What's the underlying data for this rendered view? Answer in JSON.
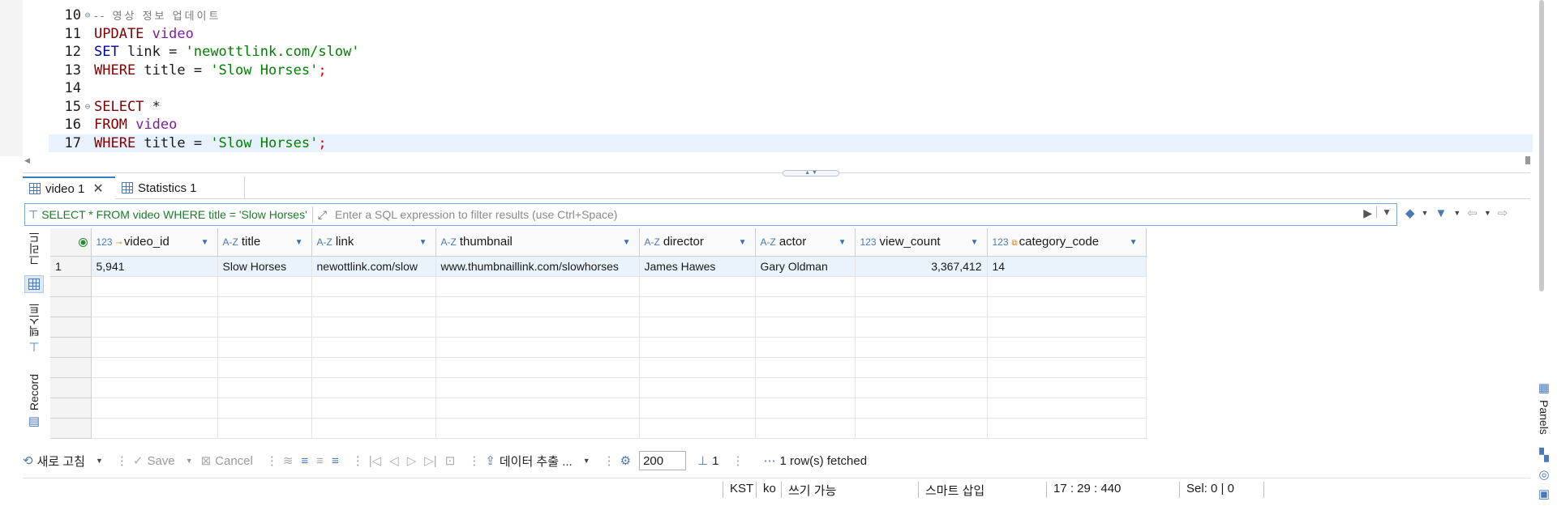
{
  "editor": {
    "lines": [
      {
        "n": "10",
        "fold": "⊖",
        "current": false,
        "tokens": [
          {
            "c": "cmt",
            "t": "-- 영상 정보 업데이트"
          }
        ]
      },
      {
        "n": "11",
        "fold": "",
        "current": false,
        "tokens": [
          {
            "c": "kw",
            "t": "UPDATE"
          },
          {
            "c": "",
            "t": " "
          },
          {
            "c": "id",
            "t": "video"
          }
        ]
      },
      {
        "n": "12",
        "fold": "",
        "current": false,
        "tokens": [
          {
            "c": "kw-blue",
            "t": "SET"
          },
          {
            "c": "",
            "t": " link = "
          },
          {
            "c": "str",
            "t": "'newottlink.com/slow'"
          }
        ]
      },
      {
        "n": "13",
        "fold": "",
        "current": false,
        "tokens": [
          {
            "c": "kw",
            "t": "WHERE"
          },
          {
            "c": "",
            "t": " title = "
          },
          {
            "c": "str",
            "t": "'Slow Horses'"
          },
          {
            "c": "sep",
            "t": ";"
          }
        ]
      },
      {
        "n": "14",
        "fold": "",
        "current": false,
        "tokens": []
      },
      {
        "n": "15",
        "fold": "⊖",
        "current": false,
        "tokens": [
          {
            "c": "kw",
            "t": "SELECT"
          },
          {
            "c": "",
            "t": " *"
          }
        ]
      },
      {
        "n": "16",
        "fold": "",
        "current": false,
        "tokens": [
          {
            "c": "kw",
            "t": "FROM"
          },
          {
            "c": "",
            "t": " "
          },
          {
            "c": "id",
            "t": "video"
          }
        ]
      },
      {
        "n": "17",
        "fold": "",
        "current": true,
        "tokens": [
          {
            "c": "kw",
            "t": "WHERE"
          },
          {
            "c": "",
            "t": " title = "
          },
          {
            "c": "str",
            "t": "'Slow Horses'"
          },
          {
            "c": "sep",
            "t": ";"
          }
        ]
      }
    ]
  },
  "tabs": {
    "active_label": "video 1",
    "other_label": "Statistics 1"
  },
  "filter": {
    "query": "SELECT * FROM video WHERE title = 'Slow Horses'",
    "placeholder": "Enter a SQL expression to filter results (use Ctrl+Space)"
  },
  "view_switcher": {
    "grid_label": "그리드",
    "text_label": "텍스트",
    "record_label": "Record"
  },
  "grid": {
    "columns": [
      {
        "type": "123",
        "name": "video_id",
        "key": true
      },
      {
        "type": "A-Z",
        "name": "title"
      },
      {
        "type": "A-Z",
        "name": "link"
      },
      {
        "type": "A-Z",
        "name": "thumbnail"
      },
      {
        "type": "A-Z",
        "name": "director"
      },
      {
        "type": "A-Z",
        "name": "actor"
      },
      {
        "type": "123",
        "name": "view_count"
      },
      {
        "type": "123",
        "name": "category_code",
        "fk": true
      }
    ],
    "rows": [
      {
        "num": "1",
        "cells": [
          "5,941",
          "Slow Horses",
          "newottlink.com/slow",
          "www.thumbnaillink.com/slowhorses",
          "James Hawes",
          "Gary Oldman",
          "3,367,412",
          "14"
        ]
      }
    ]
  },
  "toolbar": {
    "refresh_label": "새로 고침",
    "save_label": "Save",
    "cancel_label": "Cancel",
    "export_label": "데이터 추출 ...",
    "fetch_size": "200",
    "page": "1",
    "fetched_status": "1 row(s) fetched"
  },
  "status": {
    "timezone": "KST",
    "locale": "ko",
    "writable": "쓰기 가능",
    "insert_mode": "스마트 삽입",
    "position": "17 : 29 : 440",
    "selection": "Sel: 0 | 0"
  },
  "rail": {
    "panels_label": "Panels"
  }
}
